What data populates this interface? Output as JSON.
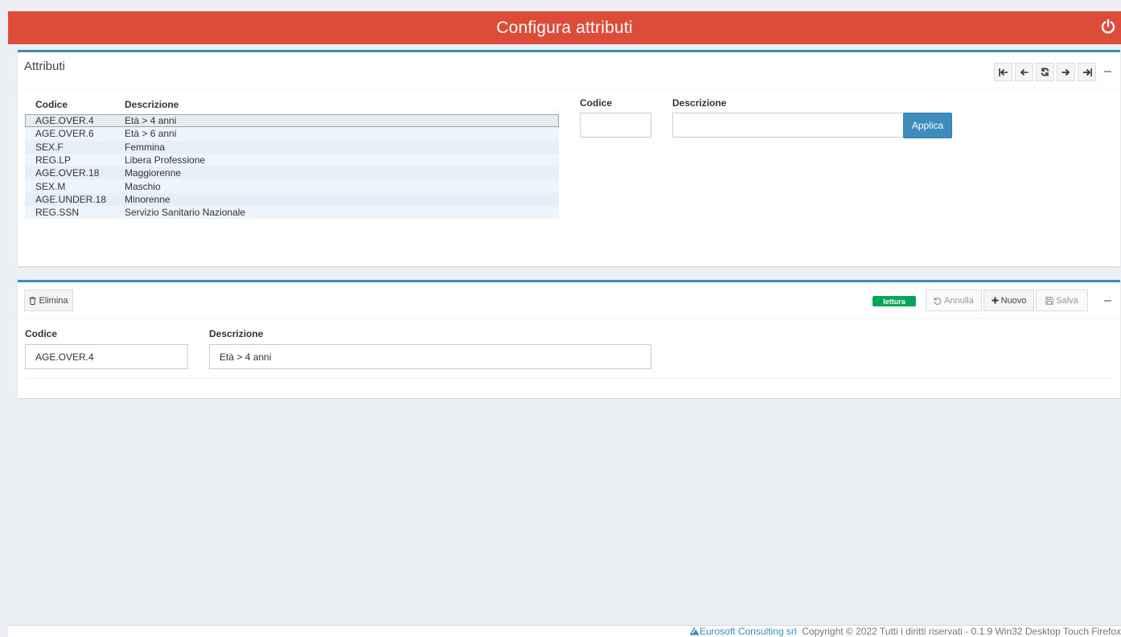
{
  "header": {
    "title": "Configura attributi",
    "accent": "#dd4b39"
  },
  "list_panel": {
    "title": "Attributi",
    "nav_buttons": [
      "first-icon",
      "prev-icon",
      "refresh-icon",
      "next-icon",
      "last-icon"
    ],
    "columns": {
      "code": "Codice",
      "description": "Descrizione"
    },
    "rows": [
      {
        "code": "AGE.OVER.4",
        "description": "Età > 4 anni",
        "selected": true
      },
      {
        "code": "AGE.OVER.6",
        "description": "Età > 6 anni"
      },
      {
        "code": "SEX.F",
        "description": "Femmina"
      },
      {
        "code": "REG.LP",
        "description": "Libera Professione"
      },
      {
        "code": "AGE.OVER.18",
        "description": "Maggiorenne"
      },
      {
        "code": "SEX.M",
        "description": "Maschio"
      },
      {
        "code": "AGE.UNDER.18",
        "description": "Minorenne"
      },
      {
        "code": "REG.SSN",
        "description": "Servizio Sanitario Nazionale"
      }
    ],
    "filter": {
      "code_label": "Codice",
      "code_value": "",
      "description_label": "Descrizione",
      "description_value": "",
      "apply_label": "Applica"
    }
  },
  "detail_panel": {
    "delete_label": "Elimina",
    "mode_badge": "lettura",
    "mode_color": "#00a65a",
    "cancel_label": "Annulla",
    "new_label": "Nuovo",
    "save_label": "Salva",
    "code_label": "Codice",
    "code_value": "AGE.OVER.4",
    "description_label": "Descrizione",
    "description_value": "Età > 4 anni"
  },
  "footer": {
    "company": "Eurosoft Consulting srl",
    "text": "  Copyright © 2022 Tutti i diritti riservati - 0.1.9 Win32 Desktop Touch Firefox"
  }
}
